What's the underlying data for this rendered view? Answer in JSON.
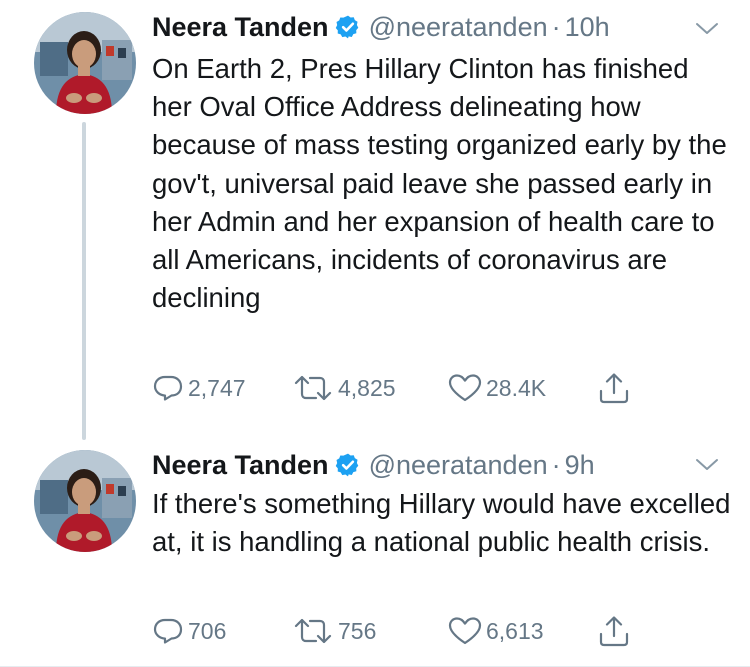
{
  "tweets": [
    {
      "author_name": "Neera Tanden",
      "handle": "@neeratanden",
      "separator": "·",
      "time": "10h",
      "text": "On Earth 2, Pres Hillary Clinton has finished her Oval Office Address delineating how because of mass testing organized early by the gov't, universal paid leave she passed early in her Admin and her expansion of health care to all Americans, incidents of coronavirus are declining",
      "replies": "2,747",
      "retweets": "4,825",
      "likes": "28.4K"
    },
    {
      "author_name": "Neera Tanden",
      "handle": "@neeratanden",
      "separator": "·",
      "time": "9h",
      "text": "If there's something Hillary would have excelled at, it is handling a national public health crisis.",
      "replies": "706",
      "retweets": "756",
      "likes": "6,613"
    }
  ],
  "icons": {
    "verified": "verified-badge-icon",
    "caret": "chevron-down-icon",
    "reply": "reply-icon",
    "retweet": "retweet-icon",
    "like": "heart-icon",
    "share": "share-icon"
  },
  "colors": {
    "verified_blue": "#1da1f2",
    "secondary_text": "#657786",
    "primary_text": "#14171a",
    "thread_line": "#ccd6dd"
  }
}
